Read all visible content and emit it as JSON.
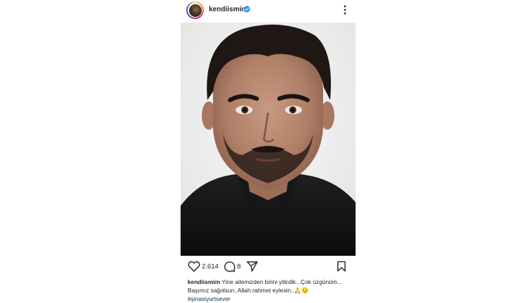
{
  "post": {
    "username": "kendiismim",
    "verified": true,
    "more_icon": "more-vertical-icon",
    "photo": {
      "subject": "portrait"
    },
    "likes": "2.614",
    "comments": "8",
    "icons": {
      "like": "heart-icon",
      "comment": "comment-icon",
      "share": "send-icon",
      "save": "bookmark-icon"
    },
    "caption": {
      "username": "kendiismim",
      "line1": "Yine ailemizden birini yitirdik...Çok üzgünüm...",
      "line2": "Başımız sağolsun..Allah rahmet eylesin..🙏😔",
      "hashtag": "#şinasiyurtsever"
    },
    "colors": {
      "verified": "#3897f0",
      "hashtag": "#00376b",
      "text": "#262626"
    }
  }
}
